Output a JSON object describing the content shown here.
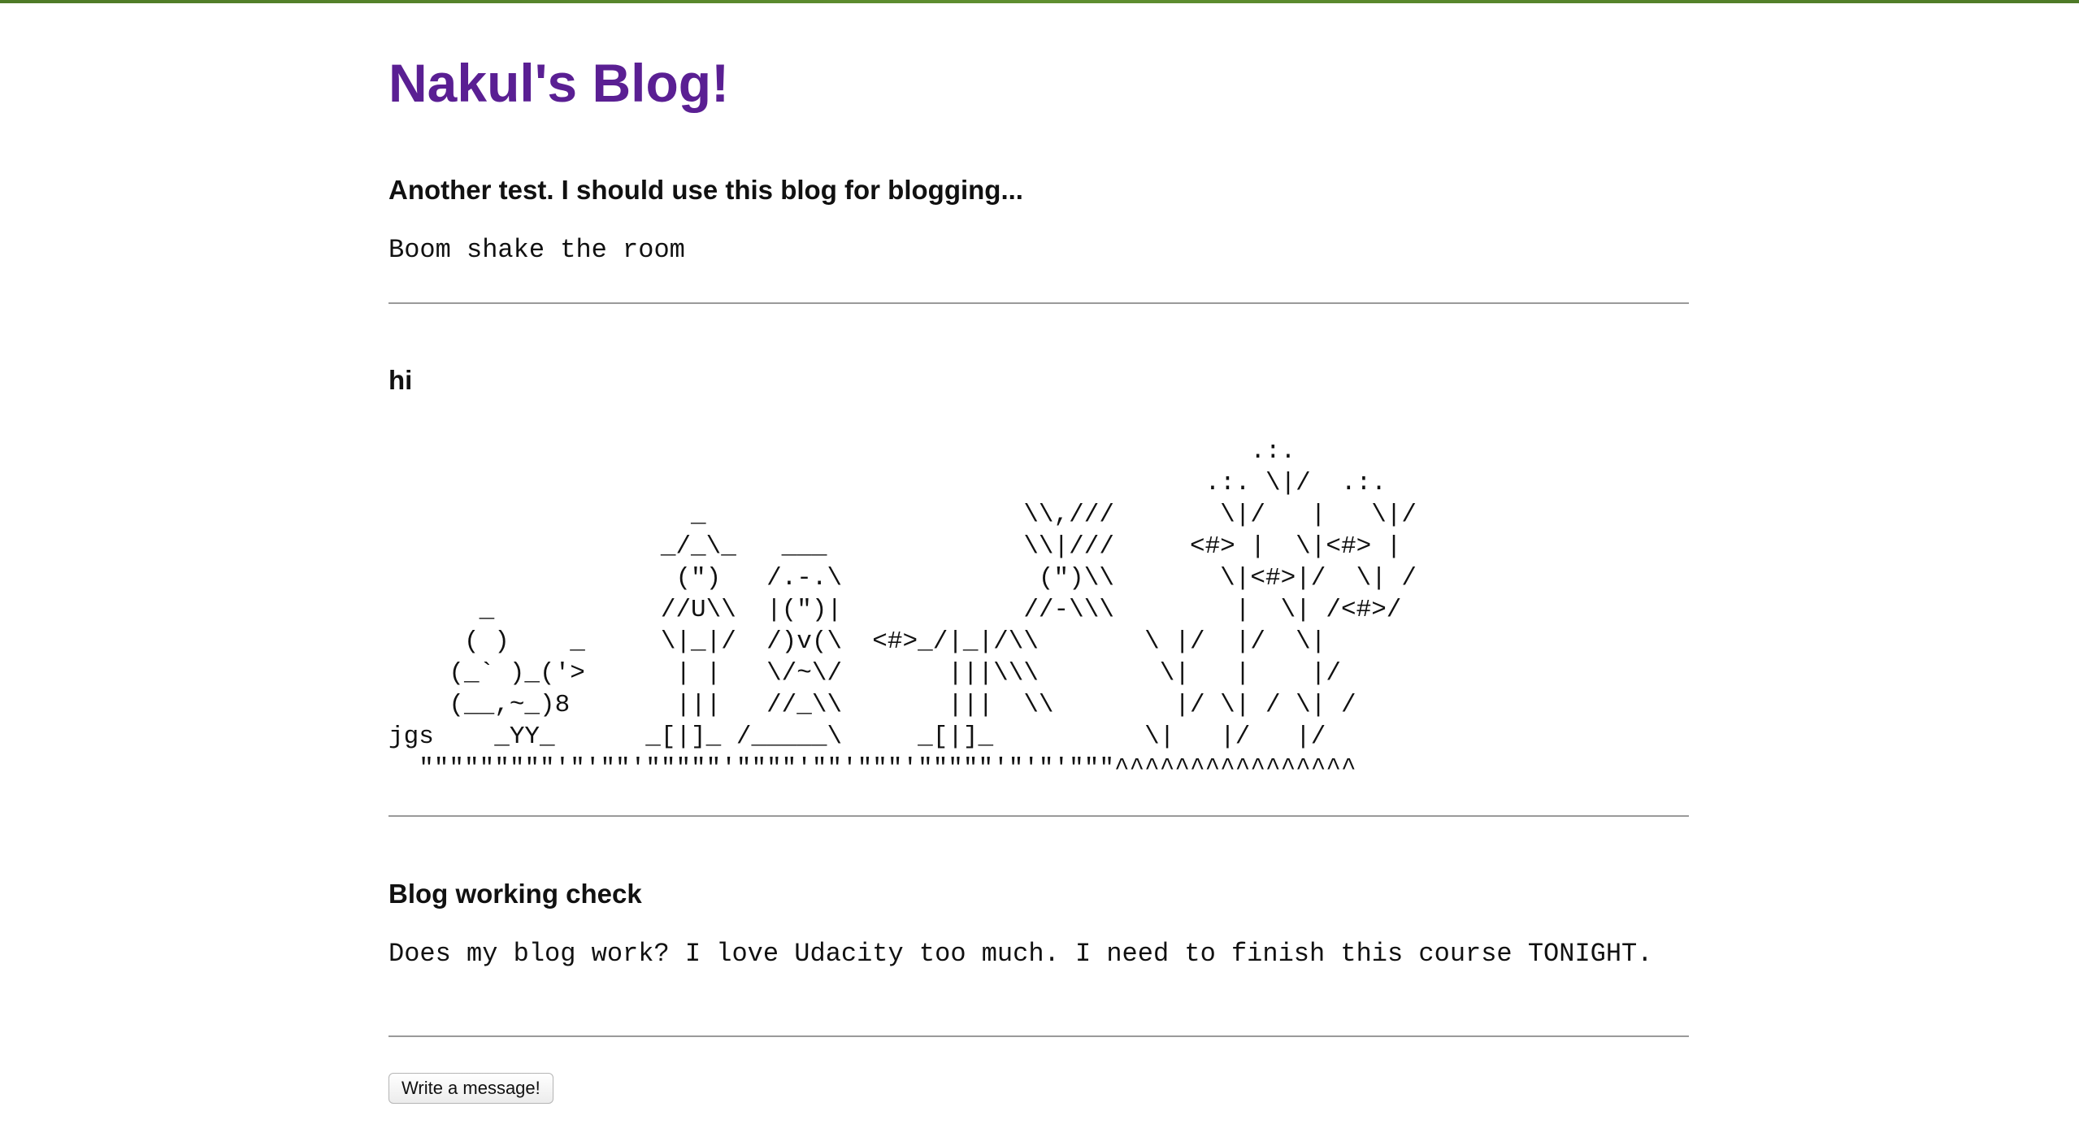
{
  "blog": {
    "title": "Nakul's Blog!"
  },
  "posts": [
    {
      "subject": "Another test. I should use this blog for blogging...",
      "content": "Boom shake the room"
    },
    {
      "subject": "hi",
      "content": "                                                         .:.\n                                                      .:. \\|/  .:.\n                    _                     \\\\,///       \\|/   |   \\|/\n                  _/_\\_   ___             \\\\|///     <#> |  \\|<#> |\n                   (\")   /.-.\\             (\")\\\\       \\|<#>|/  \\| /\n      _           //U\\\\  |(\")|            //-\\\\\\        |  \\| /<#>/\n     ( )    _     \\|_|/  /)v(\\  <#>_/|_|/\\\\       \\ |/  |/  \\|\n    (_` )_('>      | |   \\/~\\/       |||\\\\\\        \\|   |    |/\n    (__,~_)8       |||   //_\\\\       |||  \\\\        |/ \\| / \\| /\njgs    _YY_      _[|]_ /_____\\     _[|]_          \\|   |/   |/\n  \"\"\"\"\"\"\"\"\"'\"'\"\"'\"\"\"\"\"'\"\"\"\"'\"\"'\"\"\"'\"\"\"\"\"'\"'\"'\"\"\"^^^^^^^^^^^^^^^^"
    },
    {
      "subject": "Blog working check",
      "content": "Does my blog work? I love Udacity too much. I need to finish this course TONIGHT."
    }
  ],
  "actions": {
    "write_message_label": "Write a message!"
  }
}
